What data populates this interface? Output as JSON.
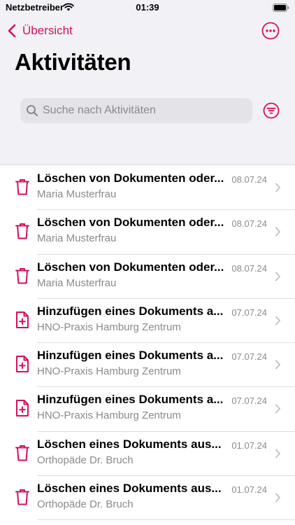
{
  "status_bar": {
    "carrier": "Netzbetreiber",
    "time": "01:39"
  },
  "nav": {
    "back_label": "Übersicht"
  },
  "page_title": "Aktivitäten",
  "search": {
    "placeholder": "Suche nach Aktivitäten",
    "value": ""
  },
  "colors": {
    "accent": "#d3105e",
    "secondary_text": "#8a8a8e",
    "header_background": "#f2f1f6"
  },
  "activities": [
    {
      "icon": "trash-icon",
      "title": "Löschen von Dokumenten oder...",
      "subtitle": "Maria Musterfrau",
      "date": "08.07.24"
    },
    {
      "icon": "trash-icon",
      "title": "Löschen von Dokumenten oder...",
      "subtitle": "Maria Musterfrau",
      "date": "08.07.24"
    },
    {
      "icon": "trash-icon",
      "title": "Löschen von Dokumenten oder...",
      "subtitle": "Maria Musterfrau",
      "date": "08.07.24"
    },
    {
      "icon": "document-add-icon",
      "title": "Hinzufügen eines Dokuments a...",
      "subtitle": "HNO-Praxis Hamburg Zentrum",
      "date": "07.07.24"
    },
    {
      "icon": "document-add-icon",
      "title": "Hinzufügen eines Dokuments a...",
      "subtitle": "HNO-Praxis Hamburg Zentrum",
      "date": "07.07.24"
    },
    {
      "icon": "document-add-icon",
      "title": "Hinzufügen eines Dokuments a...",
      "subtitle": "HNO-Praxis Hamburg Zentrum",
      "date": "07.07.24"
    },
    {
      "icon": "trash-icon",
      "title": "Löschen eines Dokuments aus...",
      "subtitle": "Orthopäde Dr. Bruch",
      "date": "01.07.24"
    },
    {
      "icon": "trash-icon",
      "title": "Löschen eines Dokuments aus...",
      "subtitle": "Orthopäde Dr. Bruch",
      "date": "01.07.24"
    }
  ]
}
